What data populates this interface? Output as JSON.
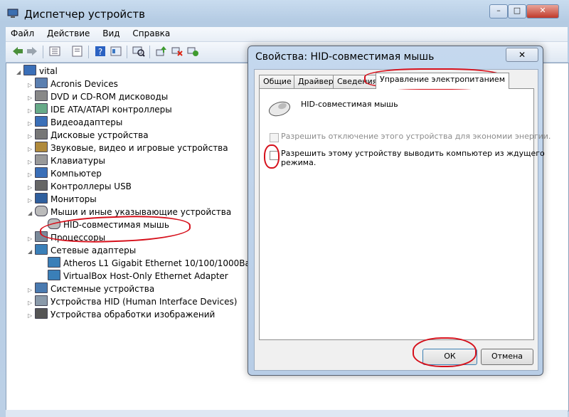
{
  "window": {
    "title": "Диспетчер устройств",
    "min": "–",
    "max": "□",
    "close": "✕"
  },
  "menu": [
    "Файл",
    "Действие",
    "Вид",
    "Справка"
  ],
  "tree": {
    "root": "vital",
    "items": [
      {
        "label": "Acronis Devices",
        "icon": "device-icon"
      },
      {
        "label": "DVD и CD-ROM дисководы",
        "icon": "disc-drive-icon"
      },
      {
        "label": "IDE ATA/ATAPI контроллеры",
        "icon": "controller-icon"
      },
      {
        "label": "Видеоадаптеры",
        "icon": "display-adapter-icon"
      },
      {
        "label": "Дисковые устройства",
        "icon": "disk-drive-icon"
      },
      {
        "label": "Звуковые, видео и игровые устройства",
        "icon": "sound-icon"
      },
      {
        "label": "Клавиатуры",
        "icon": "keyboard-icon"
      },
      {
        "label": "Компьютер",
        "icon": "computer-icon"
      },
      {
        "label": "Контроллеры USB",
        "icon": "usb-icon"
      },
      {
        "label": "Мониторы",
        "icon": "monitor-icon"
      },
      {
        "label": "Мыши и иные указывающие устройства",
        "icon": "mouse-icon"
      },
      {
        "label": "HID-совместимая мышь",
        "icon": "mouse-icon"
      },
      {
        "label": "Процессоры",
        "icon": "cpu-icon"
      },
      {
        "label": "Сетевые адаптеры",
        "icon": "network-icon"
      },
      {
        "label": "Atheros L1 Gigabit Ethernet 10/100/1000Base-T C",
        "icon": "network-icon"
      },
      {
        "label": "VirtualBox Host-Only Ethernet Adapter",
        "icon": "network-icon"
      },
      {
        "label": "Системные устройства",
        "icon": "system-icon"
      },
      {
        "label": "Устройства HID (Human Interface Devices)",
        "icon": "hid-icon"
      },
      {
        "label": "Устройства обработки изображений",
        "icon": "camera-icon"
      }
    ]
  },
  "dialog": {
    "title": "Свойства: HID-совместимая мышь",
    "close": "✕",
    "tabs": [
      "Общие",
      "Драйвер",
      "Сведения",
      "Управление электропитанием"
    ],
    "device_name": "HID-совместимая мышь",
    "option1": "Разрешить отключение этого устройства для экономии энергии.",
    "option2_line1": "Разрешить этому устройству выводить компьютер из ждущего",
    "option2_line2": "режима.",
    "ok": "ОК",
    "cancel": "Отмена"
  },
  "colors": {
    "annotation": "#d6101b",
    "titlebar": "#b9d1ea"
  }
}
